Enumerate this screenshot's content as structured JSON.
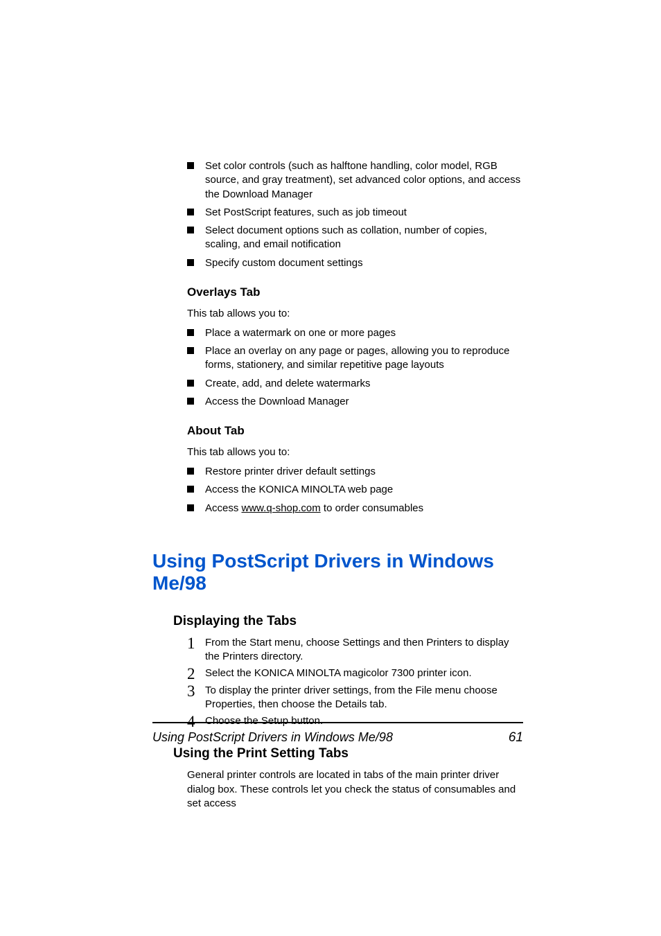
{
  "topBullets": [
    "Set color controls (such as halftone handling, color model, RGB source, and gray treatment), set advanced color options, and access the Download Manager",
    "Set PostScript features, such as job timeout",
    "Select document options such as collation, number of copies, scaling, and email notification",
    "Specify custom document settings"
  ],
  "overlays": {
    "heading": "Overlays Tab",
    "intro": "This tab allows you to:",
    "bullets": [
      "Place a watermark on one or more pages",
      "Place an overlay on any page or pages, allowing you to reproduce forms, stationery, and similar repetitive page layouts",
      "Create, add, and delete watermarks",
      "Access the Download Manager"
    ]
  },
  "about": {
    "heading": "About Tab",
    "intro": "This tab allows you to:",
    "bullets": [
      "Restore printer driver default settings",
      "Access the KONICA MINOLTA web page"
    ],
    "lastBullet": {
      "prefix": "Access ",
      "link": "www.q-shop.com",
      "suffix": " to order consumables"
    }
  },
  "mainHeading": "Using PostScript Drivers in Windows Me/98",
  "displaying": {
    "heading": "Displaying the Tabs",
    "steps": [
      "From the Start menu, choose Settings and then Printers to display the Printers directory.",
      "Select the KONICA MINOLTA magicolor 7300 printer icon.",
      "To display the printer driver settings, from the File menu choose Properties, then choose the Details tab.",
      "Choose the Setup button."
    ]
  },
  "using": {
    "heading": "Using the Print Setting Tabs",
    "body": "General printer controls are located in tabs of the main printer driver dialog box. These controls let you check the status of consumables and set access"
  },
  "footer": {
    "title": "Using PostScript Drivers in Windows Me/98",
    "page": "61"
  },
  "stepNumbers": [
    "1",
    "2",
    "3",
    "4"
  ]
}
